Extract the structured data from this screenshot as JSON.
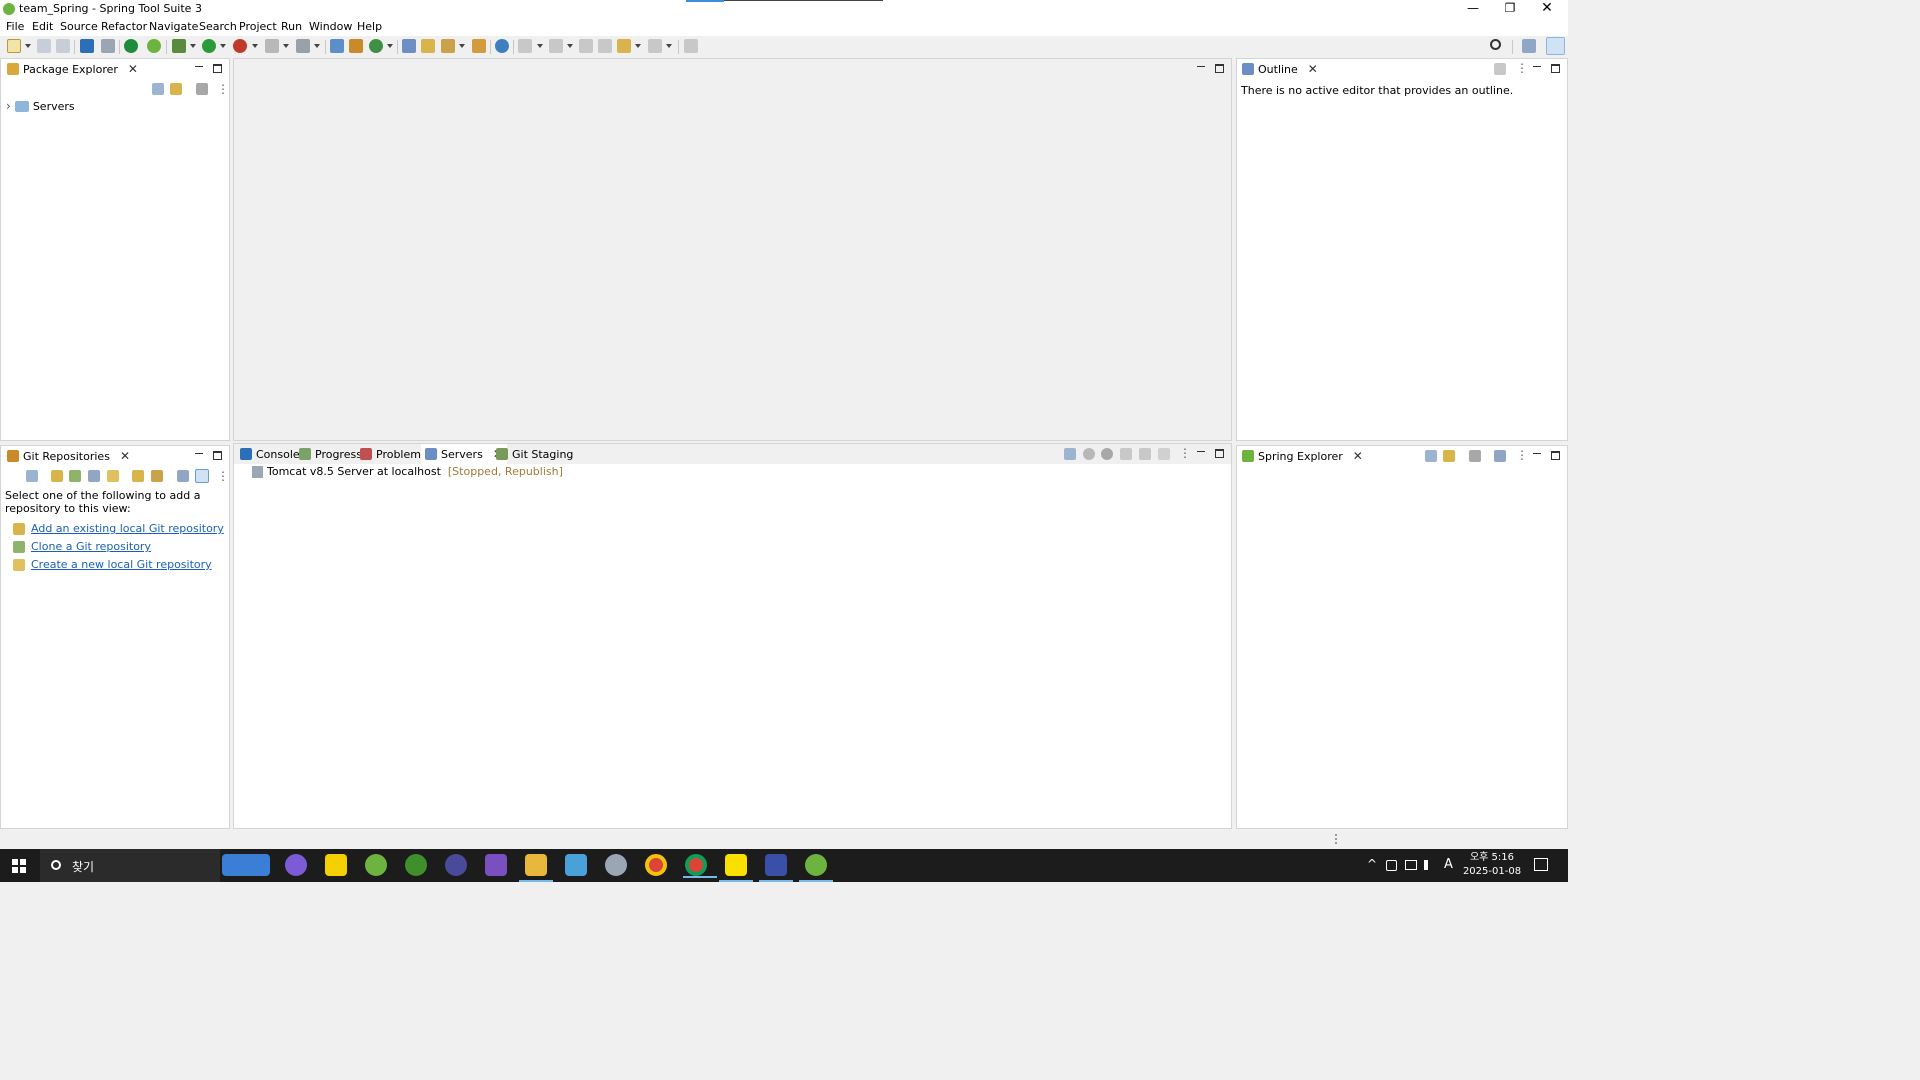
{
  "window": {
    "title": "team_Spring - Spring Tool Suite 3",
    "min_glyph": "—",
    "max_glyph": "❐",
    "close_glyph": "✕"
  },
  "menu": [
    "File",
    "Edit",
    "Source",
    "Refactor",
    "Navigate",
    "Search",
    "Project",
    "Run",
    "Window",
    "Help"
  ],
  "package_explorer": {
    "tab_label": "Package Explorer",
    "tree": [
      {
        "label": "Servers",
        "expander": "›"
      }
    ]
  },
  "git_repositories": {
    "tab_label": "Git Repositories",
    "message": "Select one of the following to add a repository to this view:",
    "links": [
      "Add an existing local Git repository",
      "Clone a Git repository",
      "Create a new local Git repository"
    ]
  },
  "outline": {
    "tab_label": "Outline",
    "message": "There is no active editor that provides an outline."
  },
  "bottom_panel": {
    "tabs": [
      "Console",
      "Progress",
      "Problems",
      "Servers",
      "Git Staging"
    ],
    "active_tab": "Servers",
    "servers": [
      {
        "name": "Tomcat v8.5 Server at localhost",
        "status": "[Stopped, Republish]"
      }
    ]
  },
  "spring_explorer": {
    "tab_label": "Spring Explorer"
  },
  "taskbar": {
    "search_placeholder": "찾기",
    "clock_ampm_time": "오후 5:16",
    "clock_date": "2025-01-08",
    "ime_indicator": "A",
    "tray_expand": "^"
  },
  "colors": {
    "link": "#1a5fbf",
    "server_status": "#a07a3a",
    "spring_green": "#6db33f",
    "taskbar_bg": "#1c1c1c"
  },
  "icons": {
    "close_tab": "✕"
  }
}
